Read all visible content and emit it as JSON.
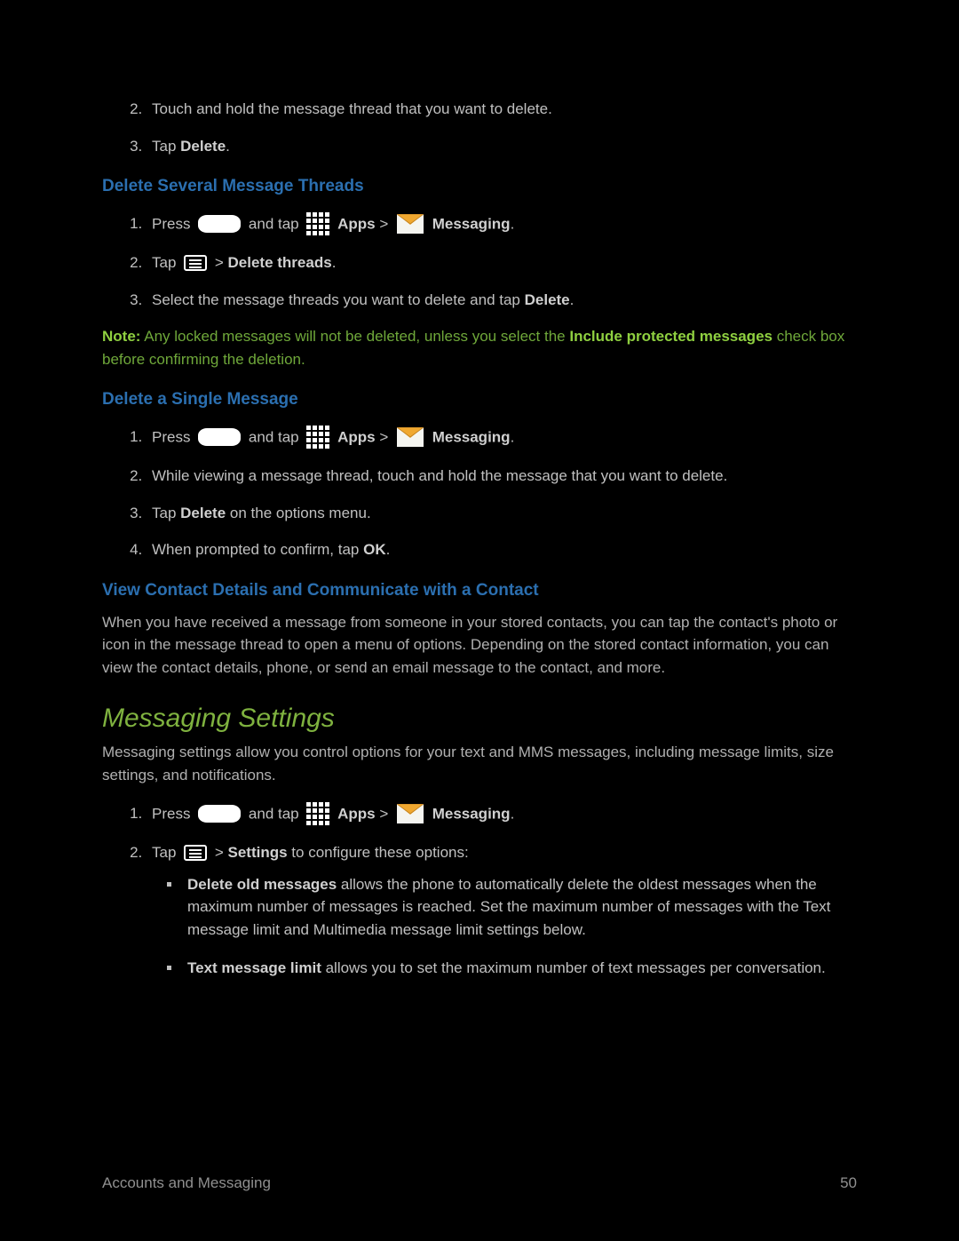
{
  "intro_list": {
    "item2": "Touch and hold the message thread that you want to delete.",
    "item3_pre": "Tap ",
    "item3_bold": "Delete",
    "item3_post": "."
  },
  "headings": {
    "delete_several": "Delete Several Message Threads",
    "delete_single": "Delete a Single Message",
    "view_contact": "View Contact Details and Communicate with a Contact",
    "messaging_settings": "Messaging Settings"
  },
  "several": {
    "item1_pre": "Press ",
    "item1_mid": " and tap ",
    "item1_apps": "Apps",
    "item1_gt": " > ",
    "item1_msg": "Messaging",
    "item1_post": ".",
    "item2_pre": "Tap ",
    "item2_gt": " > ",
    "item2_delete_threads": "Delete threads",
    "item2_post": ".",
    "item3_pre": "Select the message threads you want to delete and tap ",
    "item3_bold": "Delete",
    "item3_post": "."
  },
  "note": {
    "label": "Note:",
    "pre": " Any locked messages will not be deleted, unless you select the ",
    "bold1": "Include protected messages",
    "post": " check box before confirming the deletion."
  },
  "single": {
    "item1_pre": "Press ",
    "item1_mid": " and tap ",
    "item1_apps": "Apps",
    "item1_gt": " > ",
    "item1_msg": "Messaging",
    "item1_post": ".",
    "item2": "While viewing a message thread, touch and hold the message that you want to delete.",
    "item3_pre": "Tap ",
    "item3_bold": "Delete",
    "item3_post": " on the options menu.",
    "item4_pre": "When prompted to confirm, tap ",
    "item4_bold": "OK",
    "item4_post": "."
  },
  "view_contact_para": "When you have received a message from someone in your stored contacts, you can tap the contact's photo or icon in the message thread to open a menu of options. Depending on the stored contact information, you can view the contact details, phone, or send an email message to the contact, and more.",
  "settings_intro": "Messaging settings allow you control options for your text and MMS messages, including message limits, size settings, and notifications.",
  "settings_list": {
    "item1_pre": "Press ",
    "item1_mid": " and tap ",
    "item1_apps": "Apps",
    "item1_gt": " > ",
    "item1_msg": "Messaging",
    "item1_post": ".",
    "item2_pre": "Tap ",
    "item2_gt": " > ",
    "item2_settings": "Settings",
    "item2_post": " to configure these options:",
    "bullet1_bold": "Delete old messages",
    "bullet1_text": " allows the phone to automatically delete the oldest messages when the maximum number of messages is reached. Set the maximum number of messages with the Text message limit and Multimedia message limit settings below.",
    "bullet2_bold": "Text message limit",
    "bullet2_text": " allows you to set the maximum number of text messages per conversation."
  },
  "footer": {
    "section": "Accounts and Messaging",
    "page": "50"
  }
}
